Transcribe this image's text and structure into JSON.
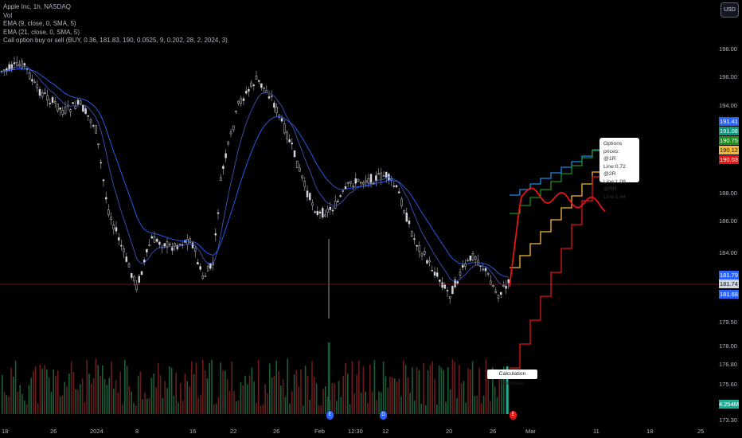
{
  "legend": {
    "line1": "Apple Inc, 1h, NASDAQ",
    "line2": "Vol",
    "line3": "EMA (9, close, 0, SMA, 5)",
    "line4": "EMA (21, close, 0, SMA, 5)",
    "line5": "Call option buy or sell (BUY, 0.36, 181.83, 190, 0.0525, 9, 0.202, 28, 2, 2024, 3)"
  },
  "currency_button": "USD",
  "options_box": {
    "title": "Options prices:",
    "line1": "@1R Line:0.72",
    "line2": "@2R Line:1.08",
    "line3": "@RR Line:1.44"
  },
  "calc_label": "Calculation Complete",
  "price_badges": [
    {
      "text": "191.41",
      "color": "#2962ff"
    },
    {
      "text": "191.08",
      "color": "#089981"
    },
    {
      "text": "190.75",
      "color": "#1b8f1b"
    },
    {
      "text": "190.12",
      "color": "#f7b731"
    },
    {
      "text": "190.03",
      "color": "#e31414"
    },
    {
      "text": "181.79",
      "color": "#2962ff"
    },
    {
      "text": "181.74",
      "color": "#d1d4dc"
    },
    {
      "text": "181.68",
      "color": "#2962ff"
    },
    {
      "text": "4.254M",
      "color": "#22ab94"
    }
  ],
  "y_ticks": [
    "198.00",
    "196.00",
    "194.00",
    "188.00",
    "186.00",
    "184.00",
    "179.50",
    "178.00",
    "176.80",
    "175.60",
    "173.30"
  ],
  "x_ticks": [
    "18",
    "26",
    "2024",
    "8",
    "16",
    "22",
    "26",
    "Feb",
    "12:30",
    "12",
    "20",
    "26",
    "Mar",
    "11",
    "18",
    "25"
  ],
  "events": [
    "E",
    "D",
    "E"
  ],
  "colors": {
    "ema9": "#b2b5be",
    "ema21": "#2962ff",
    "line1r": "#1e88e5",
    "line2r": "#1b8f1b",
    "line3r": "#f7b731",
    "lineRR": "#e31414",
    "price_line": "#8b1a1a"
  }
}
